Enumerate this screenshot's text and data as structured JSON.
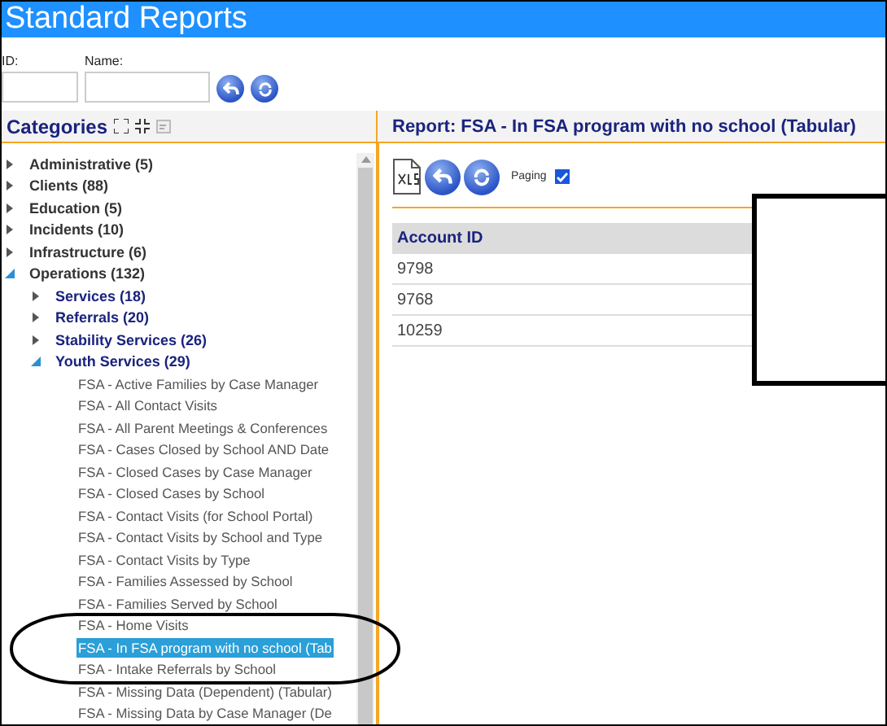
{
  "window": {
    "title": "Standard Reports"
  },
  "filters": [
    {
      "label": "ID:"
    },
    {
      "label": "Name:"
    }
  ],
  "categories": {
    "title": "Categories",
    "items": [
      {
        "label": "Administrative (5)",
        "expanded": false,
        "selected": false
      },
      {
        "label": "Clients (88)",
        "expanded": false,
        "selected": false
      },
      {
        "label": "Education (5)",
        "expanded": false,
        "selected": false
      },
      {
        "label": "Incidents (10)",
        "expanded": false,
        "selected": false
      },
      {
        "label": "Infrastructure (6)",
        "expanded": false,
        "selected": false
      },
      {
        "label": "Operations (132)",
        "expanded": true,
        "selected": false,
        "children": [
          {
            "label": "Services (18)",
            "expanded": false,
            "selected": false
          },
          {
            "label": "Referrals (20)",
            "expanded": false,
            "selected": false
          },
          {
            "label": "Stability Services (26)",
            "expanded": false,
            "selected": false
          },
          {
            "label": "Youth Services (29)",
            "expanded": true,
            "selected": false,
            "children": [
              {
                "label": "FSA - Active Families by Case Manager",
                "selected": false
              },
              {
                "label": "FSA - All Contact Visits",
                "selected": false
              },
              {
                "label": "FSA - All Parent Meetings & Conferences",
                "selected": false
              },
              {
                "label": "FSA - Cases Closed by School AND Date",
                "selected": false
              },
              {
                "label": "FSA - Closed Cases by Case Manager",
                "selected": false
              },
              {
                "label": "FSA - Closed Cases by School",
                "selected": false
              },
              {
                "label": "FSA - Contact Visits (for School Portal)",
                "selected": false
              },
              {
                "label": "FSA - Contact Visits by School and Type",
                "selected": false
              },
              {
                "label": "FSA - Contact Visits by Type",
                "selected": false
              },
              {
                "label": "FSA - Families Assessed by School",
                "selected": false
              },
              {
                "label": "FSA - Families Served by School",
                "selected": false
              },
              {
                "label": "FSA - Home Visits",
                "selected": false
              },
              {
                "label": "FSA - In FSA program with no school (Tab",
                "selected": true
              },
              {
                "label": "FSA - Intake Referrals by School",
                "selected": false
              },
              {
                "label": "FSA - Missing Data (Dependent) (Tabular)",
                "selected": false
              },
              {
                "label": "FSA - Missing Data by Case Manager (De",
                "selected": false
              }
            ]
          }
        ]
      }
    ]
  },
  "report": {
    "title": "Report: FSA - In FSA program with no school (Tabular)",
    "paging": {
      "label": "Paging",
      "checked": true
    },
    "table": {
      "columns": [
        "Account ID"
      ],
      "rows": [
        [
          "9798"
        ],
        [
          "9768"
        ],
        [
          "10259"
        ]
      ]
    }
  }
}
